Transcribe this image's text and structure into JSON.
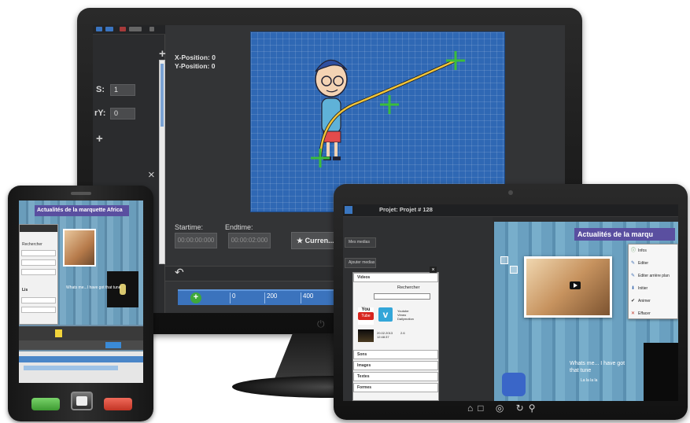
{
  "monitor": {
    "left_panel": {
      "field1_label": "S:",
      "field1_value": "1",
      "field2_label": "rY:",
      "field2_value": "0",
      "plus1": "+",
      "plus2": "+",
      "close": "×"
    },
    "position": {
      "x_label": "X-Position: 0",
      "y_label": "Y-Position: 0"
    },
    "timing": {
      "start_label": "Startime:",
      "end_label": "Endtime:",
      "start_value": "00:00:00:000",
      "end_value": "00:00:02:000",
      "current_button": "★ Curren..."
    },
    "ruler_ticks": [
      "0",
      "200",
      "400"
    ],
    "power_icon": "⏻",
    "undo_icon": "↶",
    "play_icon": "+"
  },
  "phone": {
    "title": "Actualités de la marquette Africa",
    "panel_search": "Rechercher",
    "panel_label": "Lis",
    "text_snippet": "Whats me...I have got that tune"
  },
  "tablet": {
    "window_title": "Projet: Projet # 128",
    "button1": "Mes medias",
    "button2": "Ajouter medias",
    "panel_tabs": [
      "Videos",
      "Sons",
      "Images",
      "Textes",
      "Formes"
    ],
    "search_label": "Rechercher",
    "youtube_top": "You",
    "youtube_bottom": "Tube",
    "vimeo": "v",
    "vimeo_meta": "Youtube\nVimeo\nDailymotion",
    "thumb_meta": "20.02.2013\n12:48:37",
    "thumb_size": "2.6",
    "canvas_heading": "Actualités de la marqu",
    "quote": "Whats me... I have got\nthat tune",
    "quote_small": "La la la la",
    "context_menu": [
      {
        "icon": "ⓘ",
        "label": "Infos"
      },
      {
        "icon": "✎",
        "label": "Editer"
      },
      {
        "icon": "✎",
        "label": "Editer arrière plan"
      },
      {
        "icon": "⬇",
        "label": "Initier"
      },
      {
        "icon": "✔",
        "label": "Animer"
      },
      {
        "icon": "✕",
        "label": "Effacer"
      }
    ],
    "bottom_icons": "⌂□ ◎ ↻⚲"
  },
  "colors": {
    "canvas_blue": "#2f68b4",
    "heading_purple": "#5a4fa0",
    "accent_green": "#3fa83b",
    "ruler_blue": "#3b73bd"
  }
}
